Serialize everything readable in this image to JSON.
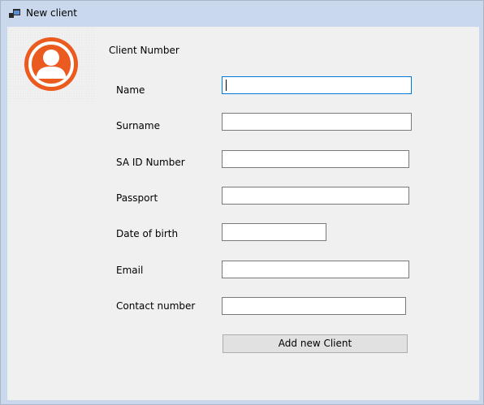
{
  "window": {
    "title": "New client"
  },
  "form": {
    "client_number_label": "Client Number",
    "fields": {
      "name": {
        "label": "Name",
        "value": ""
      },
      "surname": {
        "label": "Surname",
        "value": ""
      },
      "sa_id": {
        "label": "SA ID Number",
        "value": ""
      },
      "passport": {
        "label": "Passport",
        "value": ""
      },
      "dob": {
        "label": "Date of birth",
        "value": ""
      },
      "email": {
        "label": "Email",
        "value": ""
      },
      "contact": {
        "label": "Contact number",
        "value": ""
      }
    },
    "add_button_label": "Add new Client",
    "focused_field": "name"
  },
  "icons": {
    "window_icon": "application-form-icon",
    "avatar": "user-avatar-icon"
  },
  "colors": {
    "avatar": "#eb5a1e",
    "focus_border": "#0078d7",
    "title_bar": "#c9d8ec"
  }
}
